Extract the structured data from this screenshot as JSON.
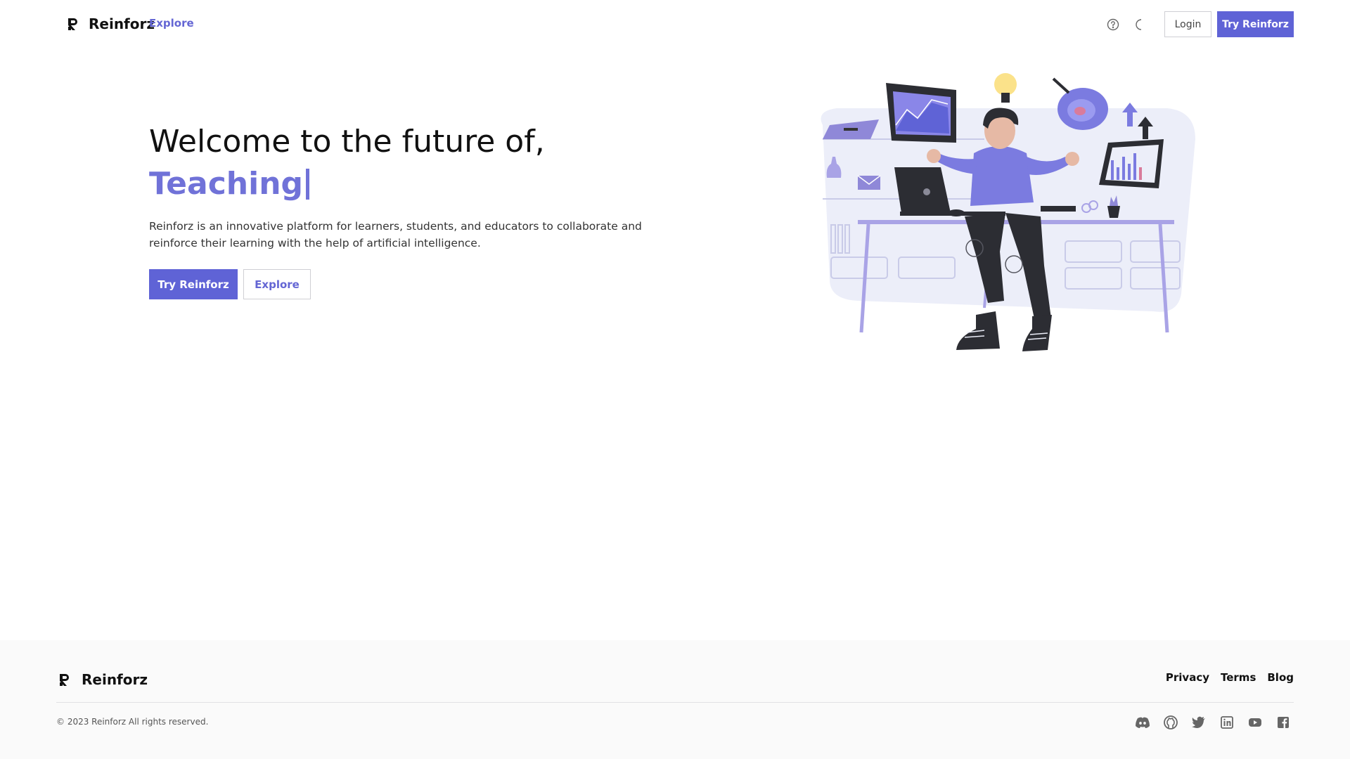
{
  "header": {
    "brand_name": "Reinforz",
    "nav_explore": "Explore",
    "help_icon": "help-circle-icon",
    "theme_icon": "moon-icon",
    "login_label": "Login",
    "try_label": "Try Reinforz"
  },
  "hero": {
    "title": "Welcome to the future of,",
    "typed_word": "Teaching",
    "description": "Reinforz is an innovative platform for learners, students, and educators to collaborate and reinforce their learning with the help of artificial intelligence.",
    "primary_button": "Try Reinforz",
    "secondary_button": "Explore"
  },
  "footer": {
    "brand_name": "Reinforz",
    "links": [
      "Privacy",
      "Terms",
      "Blog"
    ],
    "copyright": "© 2023 Reinforz All rights reserved.",
    "social_icons": [
      "discord-icon",
      "github-icon",
      "twitter-icon",
      "linkedin-icon",
      "youtube-icon",
      "facebook-icon"
    ]
  },
  "colors": {
    "accent": "#5f63d6",
    "accent_light": "#7072d8",
    "footer_bg": "#fafafa"
  }
}
